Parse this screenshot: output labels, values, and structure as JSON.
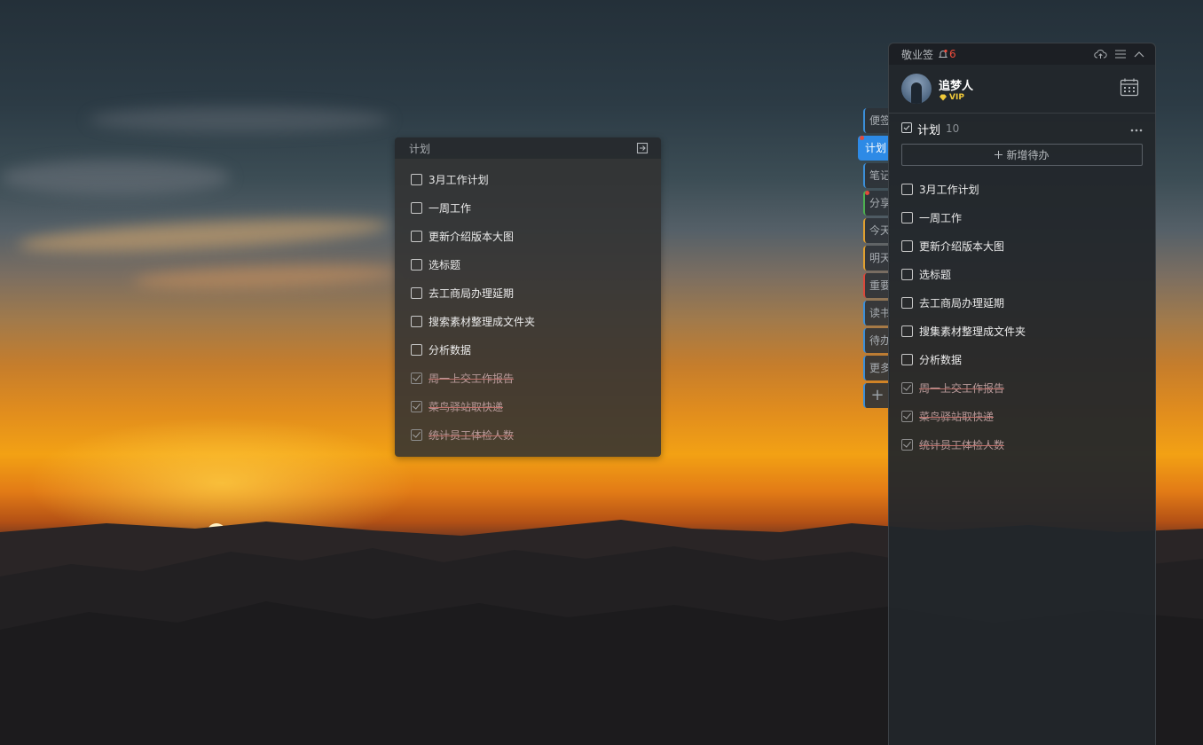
{
  "widget": {
    "title": "计划",
    "items": [
      {
        "text": "3月工作计划",
        "done": false
      },
      {
        "text": "一周工作",
        "done": false
      },
      {
        "text": "更新介绍版本大图",
        "done": false
      },
      {
        "text": "选标题",
        "done": false
      },
      {
        "text": "去工商局办理延期",
        "done": false
      },
      {
        "text": "搜索素材整理成文件夹",
        "done": false
      },
      {
        "text": "分析数据",
        "done": false
      },
      {
        "text": "周一上交工作报告",
        "done": true
      },
      {
        "text": "菜鸟驿站取快递",
        "done": true
      },
      {
        "text": "统计员工体检人数",
        "done": true
      }
    ]
  },
  "side_tabs": [
    {
      "label": "便签",
      "accent": "#3b8ed8",
      "dot": false
    },
    {
      "label": "计划",
      "accent": "#2d8ae6",
      "dot": true,
      "active": true
    },
    {
      "label": "笔记",
      "accent": "#3b8ed8",
      "dot": false
    },
    {
      "label": "分享",
      "accent": "#4caf50",
      "dot": true
    },
    {
      "label": "今天",
      "accent": "#e0a030",
      "dot": false
    },
    {
      "label": "明天",
      "accent": "#e0a030",
      "dot": false
    },
    {
      "label": "重要",
      "accent": "#d9483b",
      "dot": false
    },
    {
      "label": "读书",
      "accent": "#3b8ed8",
      "dot": false
    },
    {
      "label": "待办",
      "accent": "#3b8ed8",
      "dot": false
    },
    {
      "label": "更多",
      "accent": "#3b8ed8",
      "dot": false
    },
    {
      "label": "+",
      "accent": "#3b8ed8",
      "dot": false
    }
  ],
  "panel": {
    "app_title": "敬业签",
    "notification_count": "6",
    "user": {
      "name": "追梦人",
      "badge": "VIP"
    },
    "section": {
      "title": "计划",
      "count": "10"
    },
    "add_label": "新增待办",
    "items": [
      {
        "text": "3月工作计划",
        "done": false
      },
      {
        "text": "一周工作",
        "done": false
      },
      {
        "text": "更新介绍版本大图",
        "done": false
      },
      {
        "text": "选标题",
        "done": false
      },
      {
        "text": "去工商局办理延期",
        "done": false
      },
      {
        "text": "搜集素材整理成文件夹",
        "done": false
      },
      {
        "text": "分析数据",
        "done": false
      },
      {
        "text": "周一上交工作报告",
        "done": true
      },
      {
        "text": "菜鸟驿站取快递",
        "done": true
      },
      {
        "text": "统计员工体检人数",
        "done": true
      }
    ]
  }
}
